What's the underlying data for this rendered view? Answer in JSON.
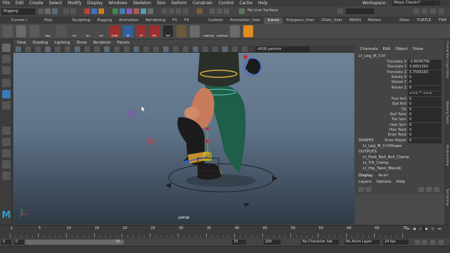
{
  "menubar": {
    "items": [
      "File",
      "Edit",
      "Create",
      "Select",
      "Modify",
      "Display",
      "Windows",
      "Skeleton",
      "Skin",
      "Deform",
      "Constrain",
      "Control",
      "Cache",
      "Help"
    ],
    "workspace_label": "Workspace :",
    "workspace_value": "Maya Classic*"
  },
  "statusline": {
    "mode": "Rigging",
    "live_surface": "No Live Surface"
  },
  "shelf": {
    "tabs": [
      "Curves / Surfaces",
      "Poly Modeling",
      "Sculpting",
      "Rigging",
      "Animation",
      "Rendering",
      "FX",
      "FX Caching",
      "Custom",
      "Animation_User",
      "Icarus",
      "Polygons_User",
      "XGen_User",
      "MASH",
      "Motion Graphics",
      "XGen",
      "TURTLE",
      "TSM"
    ],
    "active_tab": "Icarus",
    "buttons": [
      {
        "label": "",
        "color": "#5a5a5a"
      },
      {
        "label": "",
        "color": "#6a6a6a"
      },
      {
        "label": "",
        "color": "#5a5a5a"
      },
      {
        "label": "sdsc",
        "color": "#4a4a4a"
      },
      {
        "label": "",
        "color": "#555555"
      },
      {
        "label": "ctrl",
        "color": "#4a4a4a"
      },
      {
        "label": "ctrl",
        "color": "#4a4a4a"
      },
      {
        "label": "ctrl",
        "color": "#4a4a4a"
      },
      {
        "label": "SalBt",
        "color": "#9a3030"
      },
      {
        "label": "KP",
        "color": "#3060a0"
      },
      {
        "label": "CP",
        "color": "#9a3030"
      },
      {
        "label": "RPL",
        "color": "#9a3030"
      },
      {
        "label": "RSP",
        "color": "#2a2a2a"
      },
      {
        "label": "",
        "color": "#6a5a3a"
      },
      {
        "label": "",
        "color": "#6a6a6a"
      },
      {
        "label": "codeClip",
        "color": "#4a4a4a"
      },
      {
        "label": "cubeFoot",
        "color": "#4a4a4a"
      },
      {
        "label": "",
        "color": "#6a6a6a"
      },
      {
        "label": "",
        "color": "#e08a20"
      },
      {
        "label": "",
        "color": "#4a4a4a"
      },
      {
        "label": "",
        "color": "#4a4a4a"
      }
    ]
  },
  "viewport": {
    "menu": [
      "View",
      "Shading",
      "Lighting",
      "Show",
      "Renderer",
      "Panels"
    ],
    "color_space": "sRGB gamma",
    "camera_label": "persp"
  },
  "channel_box": {
    "menu": [
      "Channels",
      "Edit",
      "Object",
      "Show"
    ],
    "node_name": "Lt_Leg_IK_Ctrl",
    "transform_attrs": [
      {
        "name": "Translate X",
        "value": "-3.8036756"
      },
      {
        "name": "Translate Y",
        "value": "3.9051393"
      },
      {
        "name": "Translate Z",
        "value": "5.7505193"
      },
      {
        "name": "Rotate X",
        "value": "0"
      },
      {
        "name": "Rotate Y",
        "value": "0"
      },
      {
        "name": "Rotate Z",
        "value": "0"
      }
    ],
    "separator_value": "<<< ^ >>>",
    "custom_attrs": [
      {
        "name": "Foot Roll",
        "value": "0"
      },
      {
        "name": "Ball Roll",
        "value": "0"
      },
      {
        "name": "Tilt",
        "value": "0"
      },
      {
        "name": "Ball Twist",
        "value": "0"
      },
      {
        "name": "Toe Spin",
        "value": "0"
      },
      {
        "name": "Heel Spin",
        "value": "0"
      },
      {
        "name": "Hips Twist",
        "value": "0"
      },
      {
        "name": "Knee Twist",
        "value": "0"
      },
      {
        "name": "Knee Helper",
        "value": "0"
      }
    ],
    "shapes_title": "SHAPES",
    "shapes": [
      "Lt_Leg_IK_CtrlShape"
    ],
    "outputs_title": "OUTPUTS",
    "outputs": [
      "Lt_Foot_Ball_Roll_Clamp",
      "Lt_Tilt_Clamp",
      "Lt_Hip_Twist_BlendC"
    ]
  },
  "side_tabs": [
    "Channel Box / Layer Editor",
    "Modeling Toolkit",
    "Attribute Editor",
    "Tool Settings"
  ],
  "layer_editor": {
    "tabs": [
      "Display",
      "Anim"
    ],
    "active_tab": "Display",
    "menu": [
      "Layers",
      "Options",
      "Help"
    ]
  },
  "timeslider": {
    "ticks": [
      "1",
      "5",
      "10",
      "15",
      "20",
      "25",
      "30",
      "35",
      "40",
      "45",
      "50",
      "55",
      "60",
      "65",
      "70"
    ]
  },
  "range": {
    "start": "0",
    "inner_start": "0",
    "inner_end": "70",
    "end_a": "70",
    "end_b": "200",
    "character_set": "No Character Set",
    "anim_layer": "No Anim Layer",
    "fps": "24 fps"
  }
}
